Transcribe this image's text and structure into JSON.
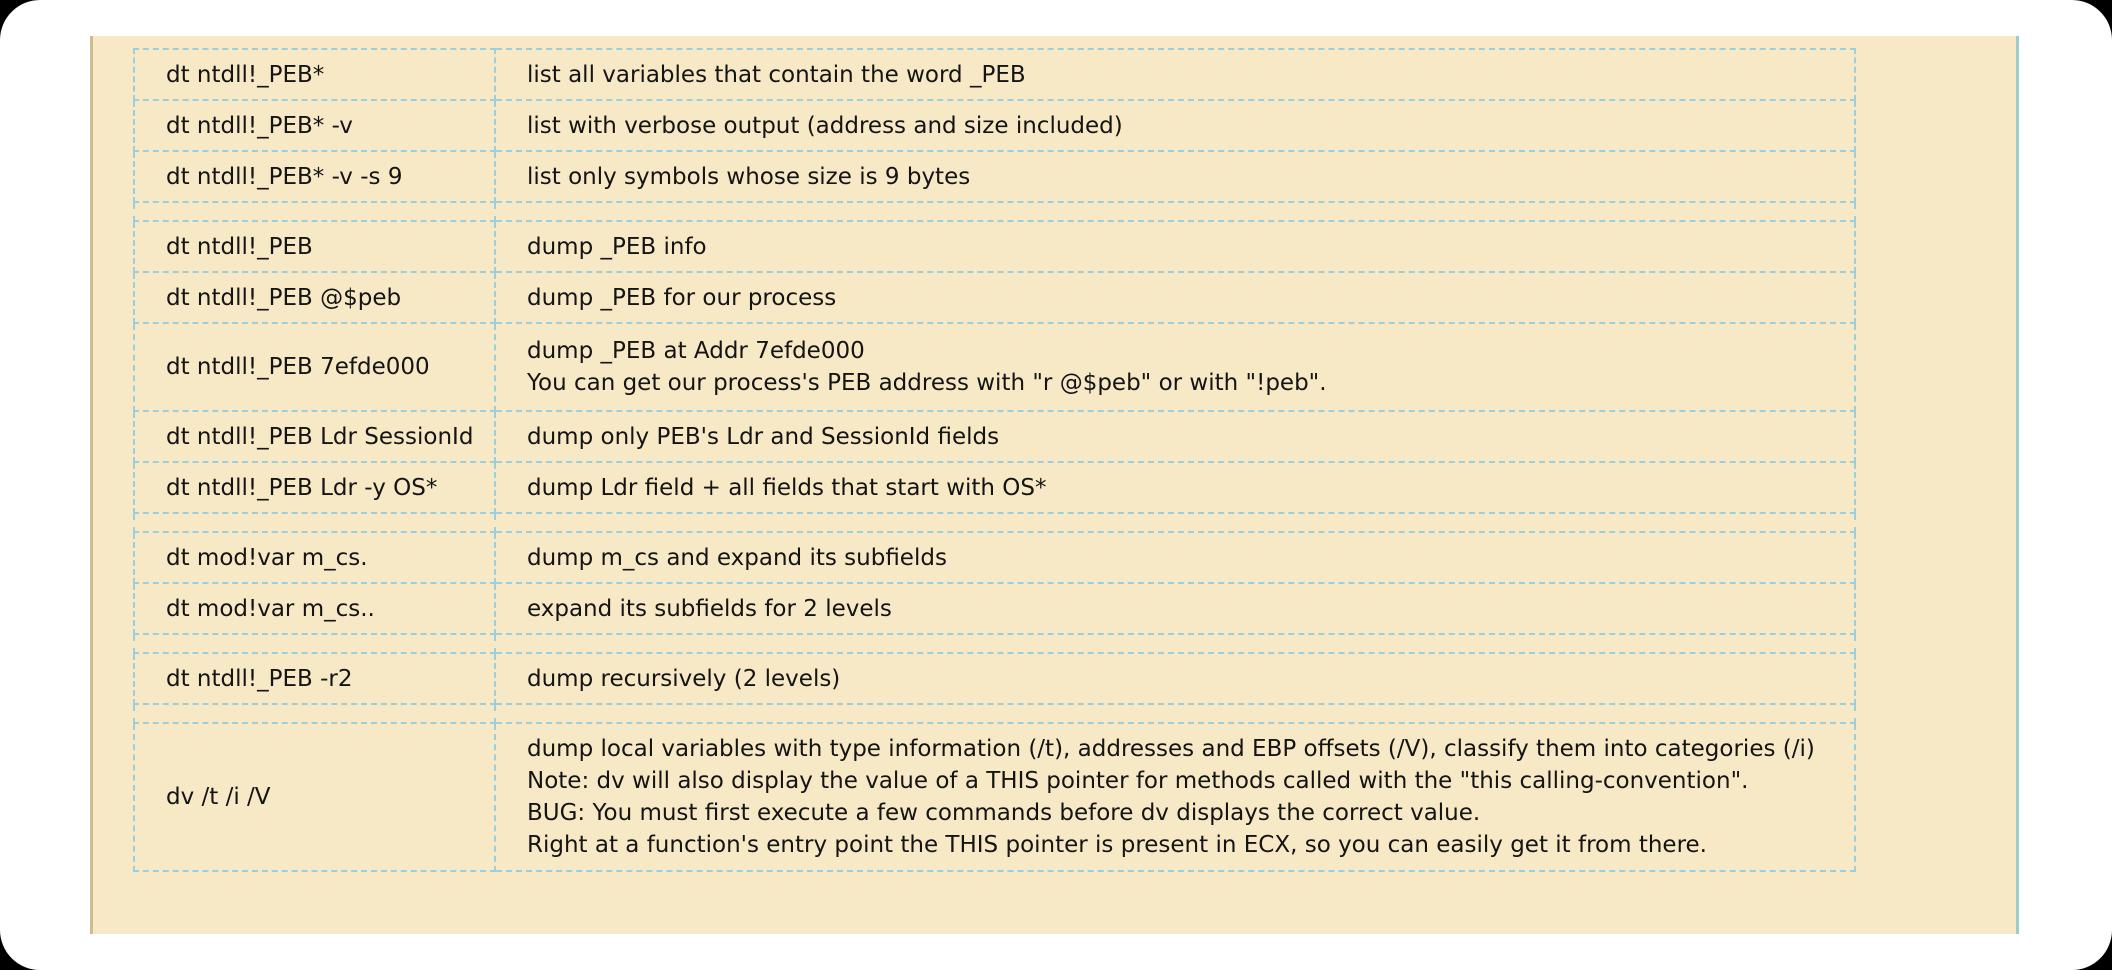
{
  "colors": {
    "panel_background": "#f7e9c6",
    "cell_border": "#9ccfdb",
    "text": "#141414"
  },
  "groups": [
    {
      "rows": [
        {
          "command": "dt ntdll!_PEB*",
          "description": [
            "list all variables that contain the word _PEB"
          ]
        },
        {
          "command": "dt ntdll!_PEB* -v",
          "description": [
            "list with verbose output (address and size included)"
          ]
        },
        {
          "command": "dt ntdll!_PEB* -v -s 9",
          "description": [
            "list only symbols whose size is 9 bytes"
          ]
        }
      ]
    },
    {
      "rows": [
        {
          "command": "dt ntdll!_PEB",
          "description": [
            "dump _PEB info"
          ]
        },
        {
          "command": "dt ntdll!_PEB @$peb",
          "description": [
            "dump _PEB for our process"
          ]
        },
        {
          "command": "dt ntdll!_PEB 7efde000",
          "description": [
            "dump _PEB at Addr 7efde000",
            "You can get our process's PEB address with \"r @$peb\" or with \"!peb\"."
          ]
        },
        {
          "command": "dt ntdll!_PEB Ldr SessionId",
          "description": [
            "dump only PEB's Ldr and SessionId fields"
          ]
        },
        {
          "command": "dt ntdll!_PEB Ldr -y OS*",
          "description": [
            "dump Ldr field + all fields that start with OS*"
          ]
        }
      ]
    },
    {
      "rows": [
        {
          "command": "dt mod!var m_cs.",
          "description": [
            "dump m_cs and expand its subfields"
          ]
        },
        {
          "command": "dt mod!var m_cs..",
          "description": [
            "expand its subfields for 2 levels"
          ]
        }
      ]
    },
    {
      "rows": [
        {
          "command": "dt ntdll!_PEB -r2",
          "description": [
            "dump recursively (2 levels)"
          ]
        }
      ]
    },
    {
      "rows": [
        {
          "command": "dv /t /i /V",
          "description": [
            "dump local variables with type information (/t), addresses and EBP offsets (/V), classify them into categories (/i)",
            "Note: dv will also display the value of a THIS pointer for methods called with the \"this calling-convention\".",
            "BUG: You must first execute a few commands before dv displays the correct value.",
            "Right at a function's entry point the THIS pointer is present in ECX, so you can easily get it from there."
          ]
        }
      ]
    }
  ]
}
